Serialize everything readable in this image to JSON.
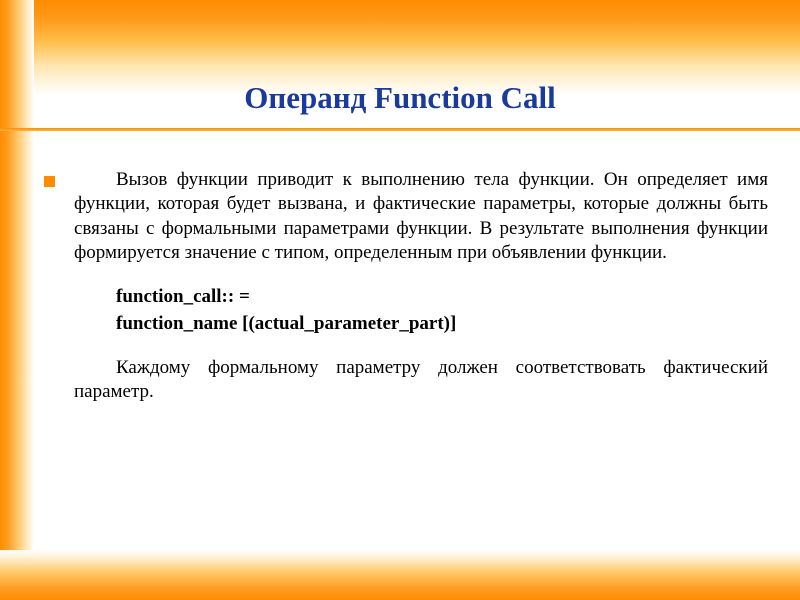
{
  "title": "Операнд Function Call",
  "paragraph1": "Вызов функции приводит к выполнению тела функции. Он определяет имя функции, которая будет вызвана, и фактические параметры, которые должны быть связаны с формальными параметрами функции. В результате выполнения функции формируется значение с типом, определенным при объявлении функции.",
  "syntax": {
    "line1": "function_call:: =",
    "line2": "function_name [(actual_parameter_part)]"
  },
  "paragraph2": "Каждому формальному параметру должен соответствовать фактический параметр."
}
